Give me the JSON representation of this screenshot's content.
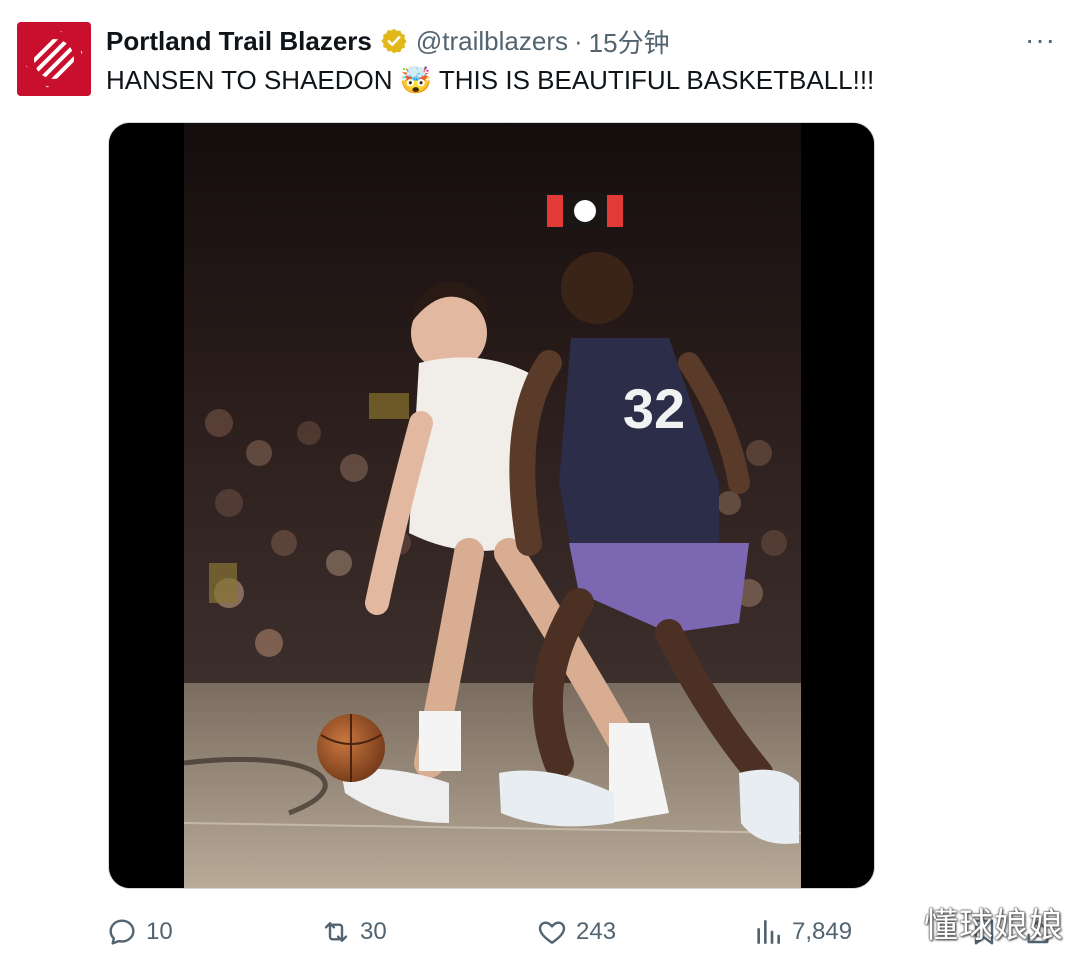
{
  "tweet": {
    "author_name": "Portland Trail Blazers",
    "handle": "@trailblazers",
    "separator": "·",
    "time": "15分钟",
    "text": "HANSEN TO SHAEDON 🤯 THIS IS BEAUTIFUL BASKETBALL!!!",
    "more_label": "···"
  },
  "media": {
    "jersey_number": "32"
  },
  "actions": {
    "replies": "10",
    "retweets": "30",
    "likes": "243",
    "views": "7,849"
  },
  "watermark": "懂球娘娘",
  "colors": {
    "brand_red": "#c8102e",
    "verified_gold": "#e2b719",
    "secondary_text": "#536471",
    "primary_text": "#0f1419"
  },
  "icons": {
    "reply": "reply-icon",
    "retweet": "retweet-icon",
    "like": "heart-icon",
    "views": "views-icon",
    "bookmark": "bookmark-icon",
    "share": "share-icon"
  }
}
